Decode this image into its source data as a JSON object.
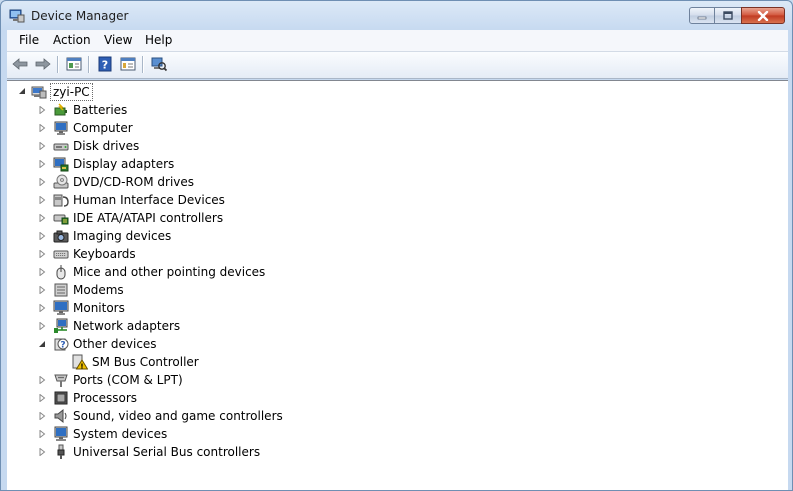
{
  "window": {
    "title": "Device Manager"
  },
  "menu": [
    "File",
    "Action",
    "View",
    "Help"
  ],
  "tree": {
    "root": "zyi-PC",
    "items": [
      "Batteries",
      "Computer",
      "Disk drives",
      "Display adapters",
      "DVD/CD-ROM drives",
      "Human Interface Devices",
      "IDE ATA/ATAPI controllers",
      "Imaging devices",
      "Keyboards",
      "Mice and other pointing devices",
      "Modems",
      "Monitors",
      "Network adapters",
      "Other devices",
      "SM Bus Controller",
      "Ports (COM & LPT)",
      "Processors",
      "Sound, video and game controllers",
      "System devices",
      "Universal Serial Bus controllers"
    ]
  },
  "colors": {
    "titlebar": "#dce9f7",
    "close": "#c03a22",
    "accent": "#2f6fc2",
    "warning": "#f0c000"
  }
}
